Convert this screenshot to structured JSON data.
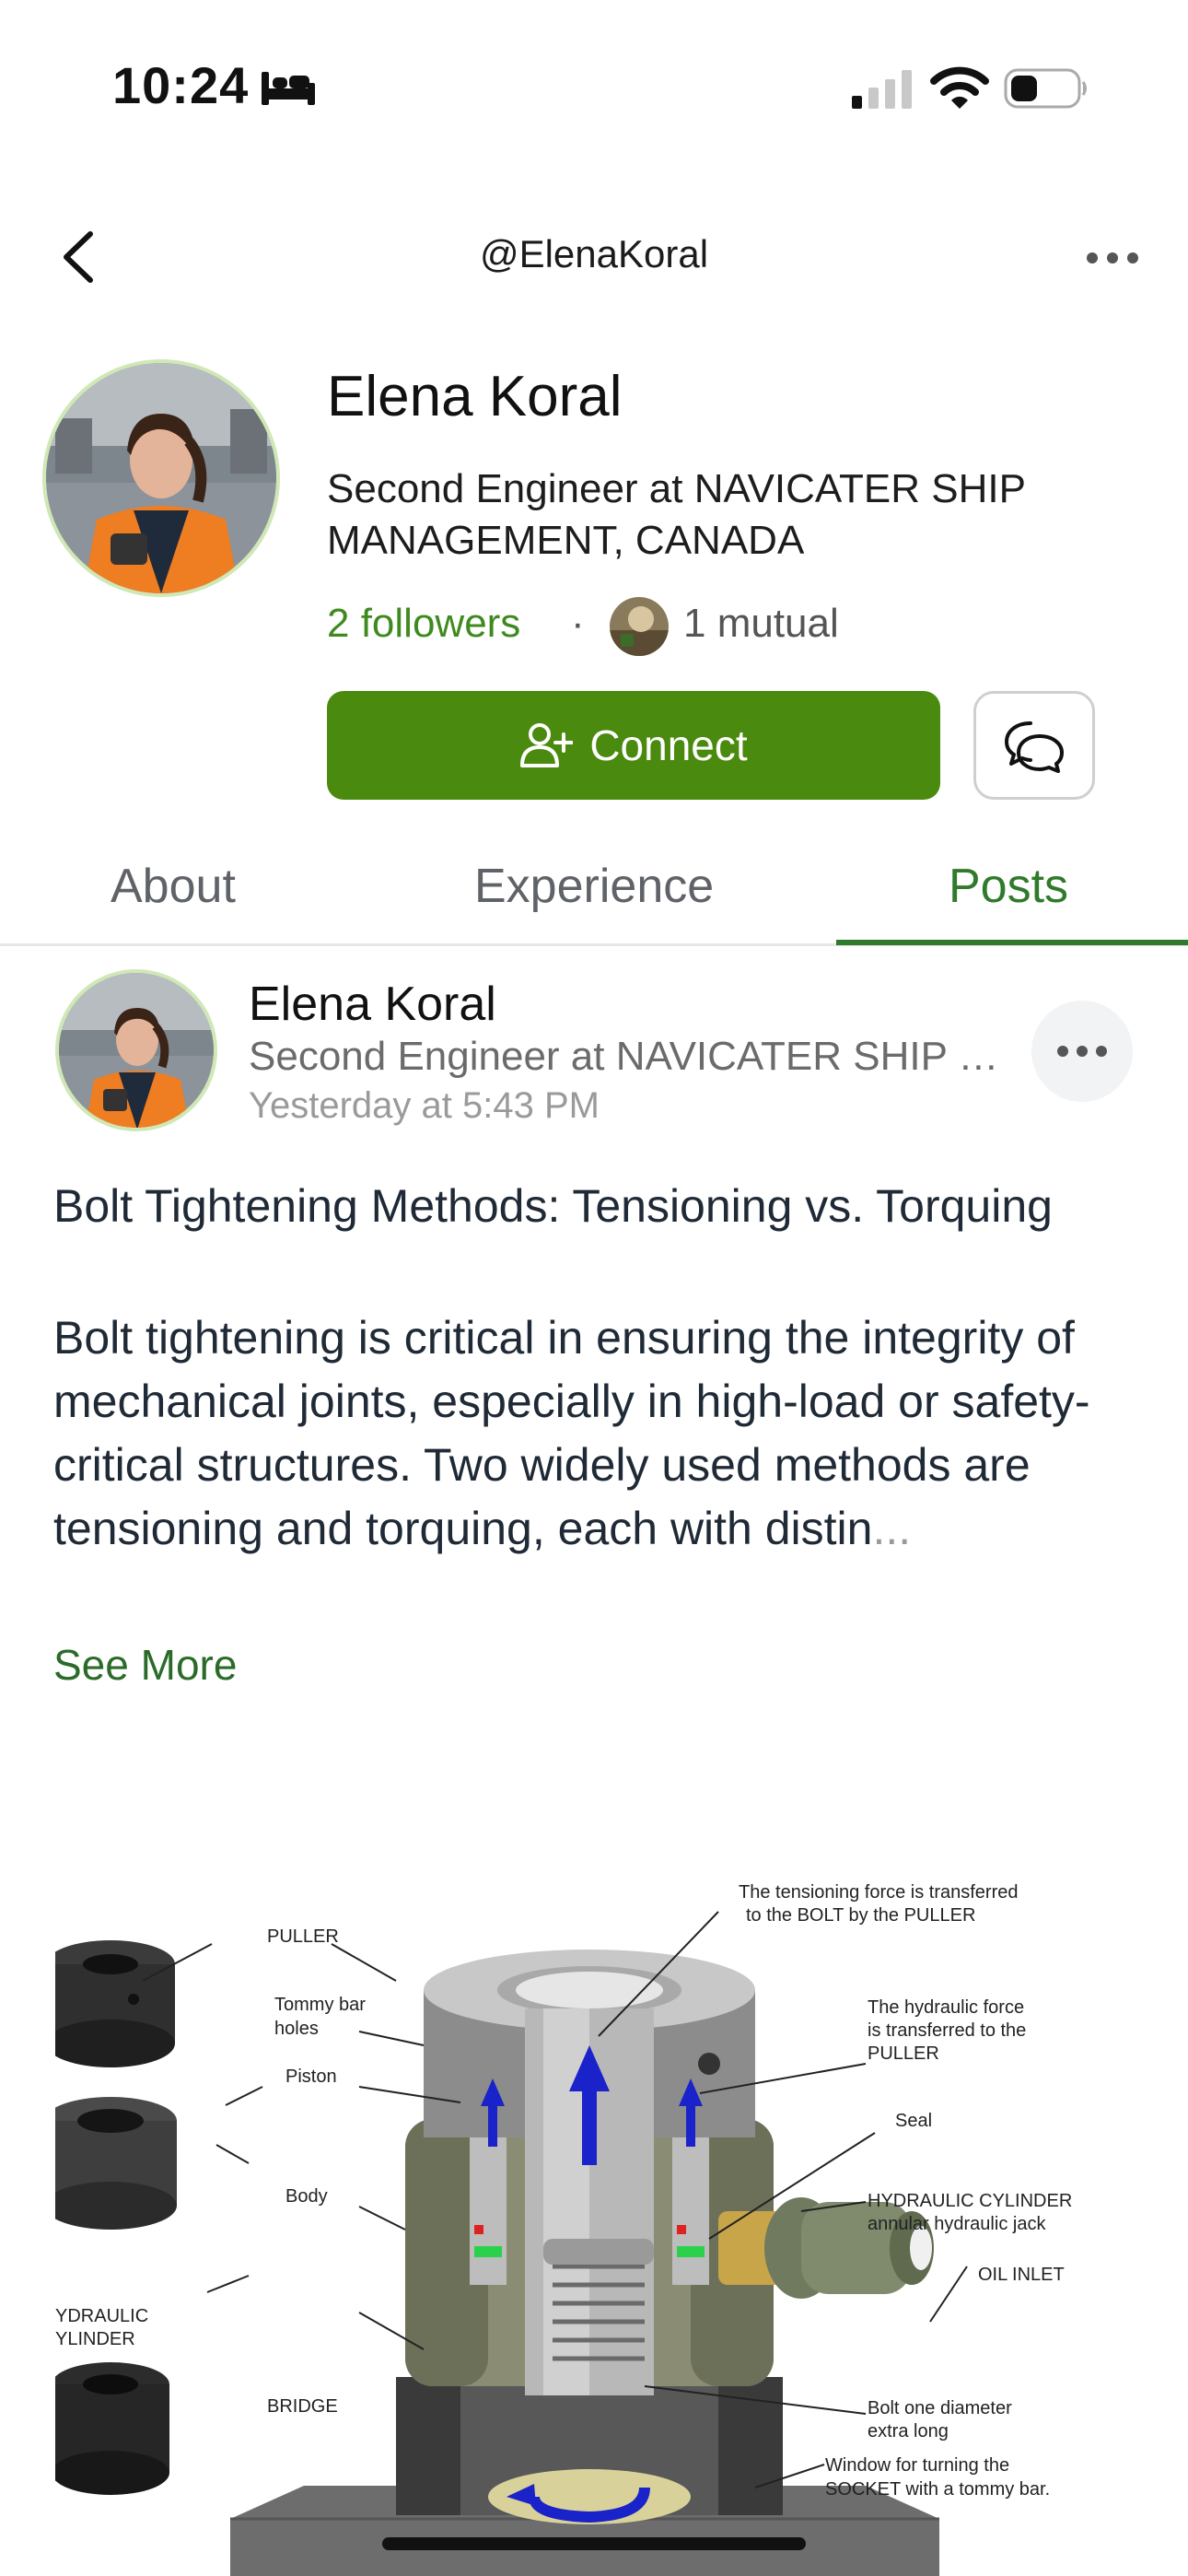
{
  "status_bar": {
    "time": "10:24"
  },
  "nav": {
    "handle": "@ElenaKoral"
  },
  "profile": {
    "name": "Elena Koral",
    "headline": "Second Engineer at NAVICATER SHIP MANAGEMENT, CANADA",
    "followers": "2 followers",
    "separator": "·",
    "mutual": "1 mutual",
    "connect_label": "Connect"
  },
  "tabs": [
    {
      "label": "About",
      "active": false
    },
    {
      "label": "Experience",
      "active": false
    },
    {
      "label": "Posts",
      "active": true
    }
  ],
  "post": {
    "author": "Elena Koral",
    "headline": "Second Engineer at NAVICATER SHIP MANAGEMENT, CANADA",
    "time": "Yesterday at 5:43 PM",
    "title": "Bolt Tightening Methods: Tensioning vs. Torquing",
    "body": "Bolt tightening is critical in ensuring the integrity of mechanical joints, especially in high-load or safety-critical structures. Two widely used methods are tensioning and torquing, each with distin",
    "ellipsis": "...",
    "see_more": "See More",
    "diagram_labels": {
      "puller": "PULLER",
      "tommy_bar_holes_1": "Tommy bar",
      "tommy_bar_holes_2": "holes",
      "piston": "Piston",
      "body": "Body",
      "hyd_cyl_1": "YDRAULIC",
      "hyd_cyl_2": "YLINDER",
      "bridge": "BRIDGE",
      "tension_note_1": "The tensioning force is transferred",
      "tension_note_2": "to the BOLT by the PULLER",
      "hydraulic_note_1": "The hydraulic force",
      "hydraulic_note_2": "is transferred to the",
      "hydraulic_note_3": "PULLER",
      "seal": "Seal",
      "cylinder_1": "HYDRAULIC  CYLINDER",
      "cylinder_2": "annular hydraulic jack",
      "oil_inlet": "OIL INLET",
      "bolt_note_1": "Bolt one diameter",
      "bolt_note_2": "extra long",
      "window_note_1": "Window for turning the",
      "window_note_2": "SOCKET  with a tommy bar."
    }
  },
  "colors": {
    "accent_green": "#4a8a0e",
    "tab_active": "#2f7a2b",
    "followers_green": "#3f8a1f"
  }
}
